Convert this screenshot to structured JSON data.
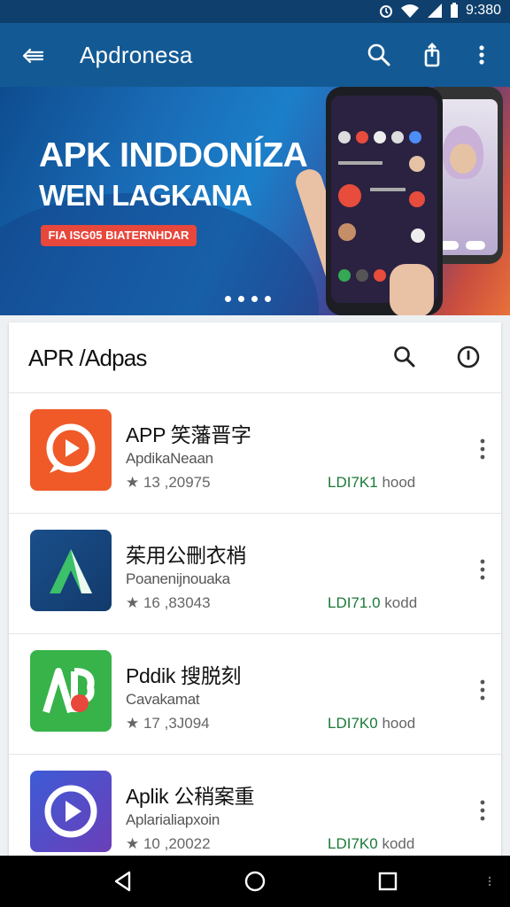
{
  "status_bar": {
    "time": "9:380",
    "icons": [
      "alarm-icon",
      "wifi-icon",
      "signal-icon",
      "battery-icon"
    ]
  },
  "app_bar": {
    "title": "Apdronesa",
    "icons": [
      "back-arrow-icon",
      "search-icon",
      "share-icon",
      "more-vert-icon"
    ]
  },
  "banner": {
    "headline_1": "APK INDDONÍZA",
    "headline_2": "WEN LAGKANA",
    "cta_label": "FIA ISG05 BIATERNHDAR",
    "slide_count": 4
  },
  "list": {
    "title": "APR /Adpas",
    "items": [
      {
        "name": "APP 笑藩晋字",
        "subtitle": "ApdikaNeaan",
        "rating": "★ 13 ,20975",
        "size_primary": "LDI7K1",
        "size_secondary": "hood",
        "icon_color": "#ef5a28"
      },
      {
        "name": "茱用公刪衣梢",
        "subtitle": "Poanenijnouaka",
        "rating": "★ 16 ,83043",
        "size_primary": "LDI71.0",
        "size_secondary": "kodd",
        "icon_color": "#1a4f8a"
      },
      {
        "name": "Pddik 搜脱刻",
        "subtitle": "Cavakamat",
        "rating": "★ 17 ,3J094",
        "size_primary": "LDI7K0",
        "size_secondary": "hood",
        "icon_color": "#37b34a"
      },
      {
        "name": "Aplik 公稍案重",
        "subtitle": "Aplarialiapxoin",
        "rating": "★ 10 ,20022",
        "size_primary": "LDI7K0",
        "size_secondary": "kodd",
        "icon_color": "#3d5bd6"
      }
    ]
  },
  "nav_bar": {
    "icons": [
      "back-triangle-icon",
      "home-circle-icon",
      "recents-square-icon"
    ]
  },
  "colors": {
    "app_bar": "#135a94",
    "status_bar": "#0f3f6c",
    "cta": "#e8473c",
    "size_green": "#1b7a38"
  }
}
